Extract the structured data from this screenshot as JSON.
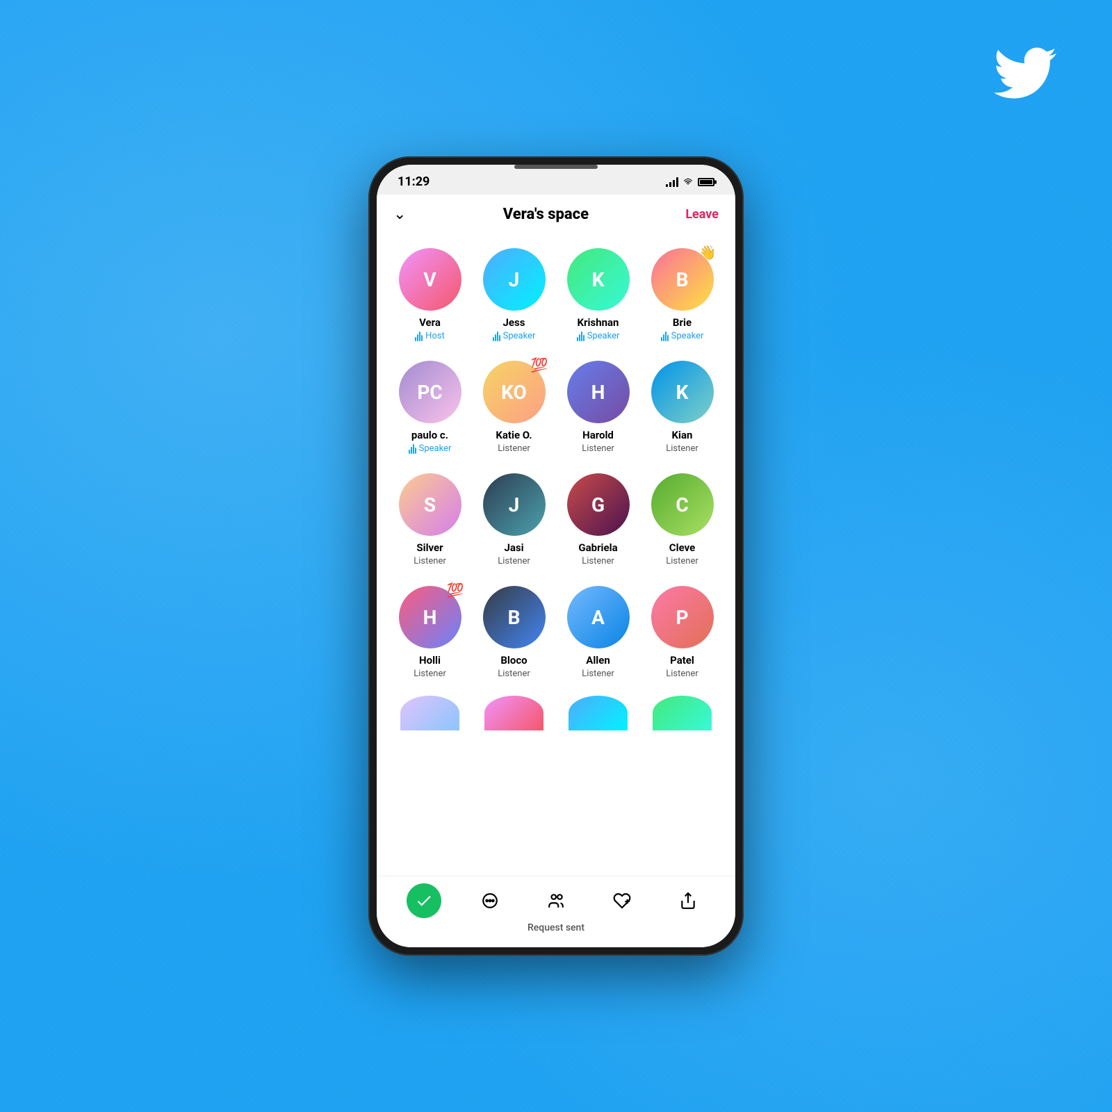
{
  "background": {
    "color": "#1da1f2"
  },
  "twitter_logo": {
    "alt": "Twitter bird logo"
  },
  "phone": {
    "status_bar": {
      "time": "11:29",
      "signal": "signal",
      "wifi": "wifi",
      "battery": "battery"
    },
    "header": {
      "chevron_label": "∨",
      "title": "Vera's space",
      "leave_button": "Leave"
    },
    "participants": [
      {
        "id": "vera",
        "name": "Vera",
        "role": "Host",
        "is_speaker": true,
        "emoji": null,
        "avatar_class": "av-vera"
      },
      {
        "id": "jess",
        "name": "Jess",
        "role": "Speaker",
        "is_speaker": true,
        "emoji": null,
        "avatar_class": "av-jess"
      },
      {
        "id": "krishnan",
        "name": "Krishnan",
        "role": "Speaker",
        "is_speaker": true,
        "emoji": null,
        "avatar_class": "av-krishnan"
      },
      {
        "id": "brie",
        "name": "Brie",
        "role": "Speaker",
        "is_speaker": true,
        "emoji": "👋",
        "avatar_class": "av-brie"
      },
      {
        "id": "paulo",
        "name": "paulo c.",
        "role": "Speaker",
        "is_speaker": true,
        "emoji": null,
        "avatar_class": "av-paulo"
      },
      {
        "id": "katie",
        "name": "Katie O.",
        "role": "Listener",
        "is_speaker": false,
        "emoji": "💯",
        "avatar_class": "av-katie"
      },
      {
        "id": "harold",
        "name": "Harold",
        "role": "Listener",
        "is_speaker": false,
        "emoji": null,
        "avatar_class": "av-harold"
      },
      {
        "id": "kian",
        "name": "Kian",
        "role": "Listener",
        "is_speaker": false,
        "emoji": null,
        "avatar_class": "av-kian"
      },
      {
        "id": "silver",
        "name": "Silver",
        "role": "Listener",
        "is_speaker": false,
        "emoji": null,
        "avatar_class": "av-silver"
      },
      {
        "id": "jasi",
        "name": "Jasi",
        "role": "Listener",
        "is_speaker": false,
        "emoji": null,
        "avatar_class": "av-jasi"
      },
      {
        "id": "gabriela",
        "name": "Gabriela",
        "role": "Listener",
        "is_speaker": false,
        "emoji": null,
        "avatar_class": "av-gabriela"
      },
      {
        "id": "cleve",
        "name": "Cleve",
        "role": "Listener",
        "is_speaker": false,
        "emoji": null,
        "avatar_class": "av-cleve"
      },
      {
        "id": "holli",
        "name": "Holli",
        "role": "Listener",
        "is_speaker": false,
        "emoji": "💯",
        "avatar_class": "av-holli"
      },
      {
        "id": "bloco",
        "name": "Bloco",
        "role": "Listener",
        "is_speaker": false,
        "emoji": null,
        "avatar_class": "av-bloco"
      },
      {
        "id": "allen",
        "name": "Allen",
        "role": "Listener",
        "is_speaker": false,
        "emoji": null,
        "avatar_class": "av-allen"
      },
      {
        "id": "patel",
        "name": "Patel",
        "role": "Listener",
        "is_speaker": false,
        "emoji": null,
        "avatar_class": "av-patel"
      }
    ],
    "partial_participants": [
      {
        "id": "p17",
        "avatar_class": "av-p17"
      },
      {
        "id": "p18",
        "avatar_class": "av-p18"
      },
      {
        "id": "p19",
        "avatar_class": "av-p19"
      },
      {
        "id": "p20",
        "avatar_class": "av-p20"
      }
    ],
    "bottom_bar": {
      "request_sent": "Request sent",
      "actions": [
        {
          "id": "check",
          "label": "✓",
          "type": "green"
        },
        {
          "id": "chat",
          "label": "chat"
        },
        {
          "id": "people",
          "label": "people"
        },
        {
          "id": "heart-plus",
          "label": "heart-plus"
        },
        {
          "id": "share",
          "label": "share"
        }
      ]
    }
  }
}
